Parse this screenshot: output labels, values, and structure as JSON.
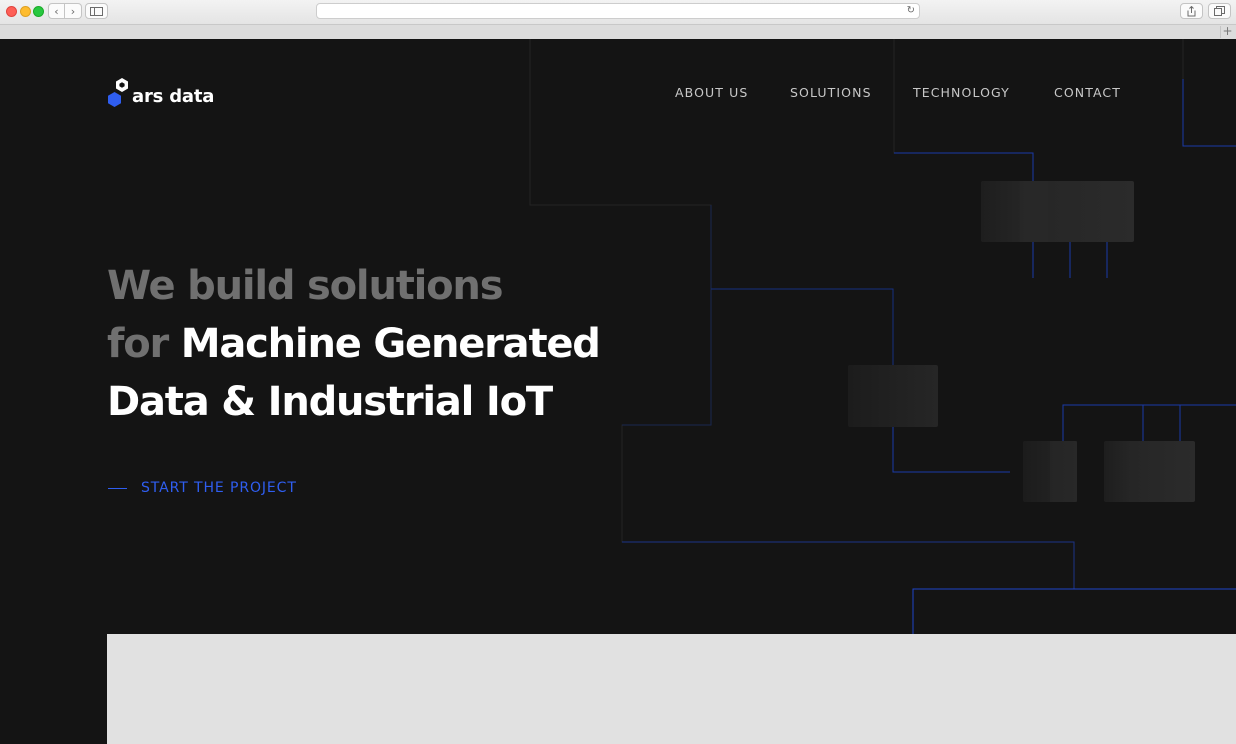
{
  "browser": {
    "url": "",
    "reload_glyph": "↻",
    "back_glyph": "‹",
    "forward_glyph": "›",
    "new_tab_glyph": "+"
  },
  "site": {
    "logo_text": "ars data",
    "nav": [
      {
        "label": "ABOUT US"
      },
      {
        "label": "SOLUTIONS"
      },
      {
        "label": "TECHNOLOGY"
      },
      {
        "label": "CONTACT"
      }
    ],
    "hero": {
      "line1_dim": "We build solutions",
      "line2_dim": "for",
      "line2_bright": "Machine Generated",
      "line3_bright": "Data & Industrial IoT"
    },
    "cta_label": "START THE PROJECT"
  },
  "colors": {
    "page_background": "#141414",
    "accent": "#2f5ef0",
    "circuit_line": "#1a3aa8",
    "heading_dim": "#707070",
    "heading_bright": "#ffffff",
    "panel": "#e1e1e1"
  }
}
